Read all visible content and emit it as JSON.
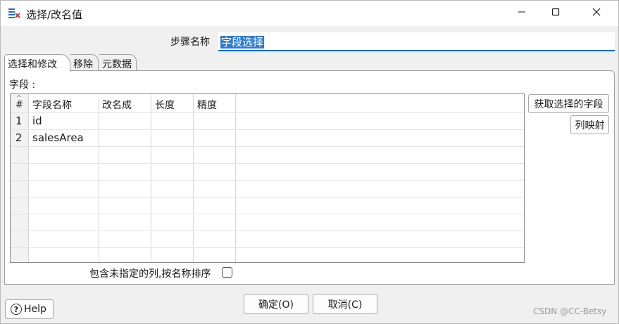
{
  "window": {
    "title": "选择/改名值",
    "icon": "select-rename-app-icon"
  },
  "step": {
    "label": "步骤名称",
    "value": "字段选择"
  },
  "tabs": [
    {
      "label": "选择和修改",
      "active": true
    },
    {
      "label": "移除",
      "active": false
    },
    {
      "label": "元数据",
      "active": false
    }
  ],
  "fields": {
    "label": "字段 :",
    "columns": [
      "#",
      "字段名称",
      "改名成",
      "长度",
      "精度"
    ],
    "rows": [
      {
        "num": "1",
        "name": "id",
        "rename": "",
        "length": "",
        "precision": ""
      },
      {
        "num": "2",
        "name": "salesArea",
        "rename": "",
        "length": "",
        "precision": ""
      }
    ]
  },
  "buttons": {
    "get_fields": "获取选择的字段",
    "mapping": "列映射",
    "ok": "确定(O)",
    "cancel": "取消(C)",
    "help": "Help"
  },
  "include_unspecified": {
    "label": "包含未指定的列,按名称排序",
    "checked": false
  },
  "watermark": "CSDN @CC-Betsy",
  "colors": {
    "accent": "#0b6ac7",
    "selection": "#2f7bd0"
  }
}
